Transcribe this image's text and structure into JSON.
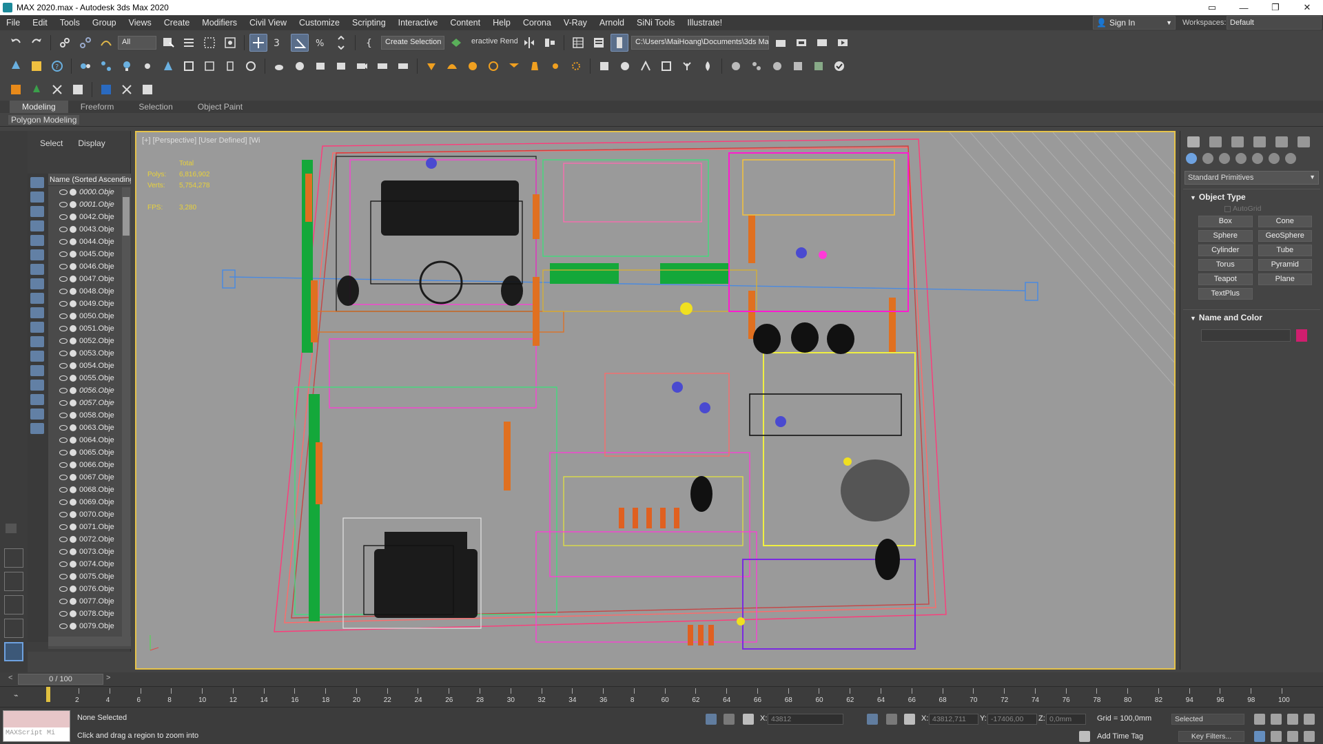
{
  "window": {
    "title": "MAX 2020.max - Autodesk 3ds Max 2020"
  },
  "menu": [
    "File",
    "Edit",
    "Tools",
    "Group",
    "Views",
    "Create",
    "Modifiers",
    "Civil View",
    "Customize",
    "Scripting",
    "Interactive",
    "Content",
    "Help",
    "Corona",
    "V-Ray",
    "Arnold",
    "SiNi Tools",
    "Illustrate!"
  ],
  "account": {
    "sign_in": "Sign In",
    "workspaces_label": "Workspaces:",
    "workspace": "Default"
  },
  "toolbar": {
    "filter": "All",
    "selection_set": "Create Selection Se",
    "render_label": "eractive Rend",
    "project_path": "C:\\Users\\MaiHoang\\Documents\\3ds Max 2020"
  },
  "ribbon": {
    "tabs": [
      "Modeling",
      "Freeform",
      "Selection",
      "Object Paint"
    ],
    "active": "Modeling",
    "sub_label": "Polygon Modeling"
  },
  "explorer": {
    "tabs": [
      "Select",
      "Display"
    ],
    "column_header": "Name (Sorted Ascending",
    "items": [
      {
        "name": "0000.Obje",
        "italic": true
      },
      {
        "name": "0001.Obje",
        "italic": true
      },
      {
        "name": "0042.Obje",
        "italic": false
      },
      {
        "name": "0043.Obje",
        "italic": false
      },
      {
        "name": "0044.Obje",
        "italic": false
      },
      {
        "name": "0045.Obje",
        "italic": false
      },
      {
        "name": "0046.Obje",
        "italic": false
      },
      {
        "name": "0047.Obje",
        "italic": false
      },
      {
        "name": "0048.Obje",
        "italic": false
      },
      {
        "name": "0049.Obje",
        "italic": false
      },
      {
        "name": "0050.Obje",
        "italic": false
      },
      {
        "name": "0051.Obje",
        "italic": false
      },
      {
        "name": "0052.Obje",
        "italic": false
      },
      {
        "name": "0053.Obje",
        "italic": false
      },
      {
        "name": "0054.Obje",
        "italic": false
      },
      {
        "name": "0055.Obje",
        "italic": false
      },
      {
        "name": "0056.Obje",
        "italic": true
      },
      {
        "name": "0057.Obje",
        "italic": true
      },
      {
        "name": "0058.Obje",
        "italic": false
      },
      {
        "name": "0063.Obje",
        "italic": false
      },
      {
        "name": "0064.Obje",
        "italic": false
      },
      {
        "name": "0065.Obje",
        "italic": false
      },
      {
        "name": "0066.Obje",
        "italic": false
      },
      {
        "name": "0067.Obje",
        "italic": false
      },
      {
        "name": "0068.Obje",
        "italic": false
      },
      {
        "name": "0069.Obje",
        "italic": false
      },
      {
        "name": "0070.Obje",
        "italic": false
      },
      {
        "name": "0071.Obje",
        "italic": false
      },
      {
        "name": "0072.Obje",
        "italic": false
      },
      {
        "name": "0073.Obje",
        "italic": false
      },
      {
        "name": "0074.Obje",
        "italic": false
      },
      {
        "name": "0075.Obje",
        "italic": false
      },
      {
        "name": "0076.Obje",
        "italic": false
      },
      {
        "name": "0077.Obje",
        "italic": false
      },
      {
        "name": "0078.Obje",
        "italic": false
      },
      {
        "name": "0079.Obje",
        "italic": false
      }
    ]
  },
  "viewport": {
    "label": "[+] [Perspective] [User Defined] [Wi",
    "stats": {
      "total": "Total",
      "polys_label": "Polys:",
      "polys": "6,816,902",
      "verts_label": "Verts:",
      "verts": "5,754,278",
      "fps_label": "FPS:",
      "fps": "3,280"
    }
  },
  "command_panel": {
    "category": "Standard Primitives",
    "object_type_title": "Object Type",
    "autogrid": "AutoGrid",
    "buttons": [
      "Box",
      "Cone",
      "Sphere",
      "GeoSphere",
      "Cylinder",
      "Tube",
      "Torus",
      "Pyramid",
      "Teapot",
      "Plane",
      "TextPlus"
    ],
    "name_color_title": "Name and Color",
    "swatch_color": "#d01e6e"
  },
  "timeline": {
    "slider": "0 / 100",
    "ticks": [
      "2",
      "4",
      "6",
      "8",
      "10",
      "12",
      "14",
      "16",
      "18",
      "20",
      "22",
      "24",
      "26",
      "28",
      "30",
      "32",
      "34",
      "36",
      "8",
      "60",
      "62",
      "64",
      "66",
      "68",
      "60",
      "62",
      "64",
      "66",
      "68",
      "70",
      "72",
      "74",
      "76",
      "78",
      "80",
      "82",
      "94",
      "96",
      "98",
      "100"
    ]
  },
  "status": {
    "maxscript": "MAXScript Mi",
    "selection": "None Selected",
    "prompt": "Click and drag a region to zoom into",
    "x1_label": "X:",
    "x1": "43812",
    "x_label": "X:",
    "x": "43812,711",
    "y_label": "Y:",
    "y": "-17406,00",
    "z_label": "Z:",
    "z": "0,0mm",
    "grid": "Grid = 100,0mm",
    "selected": "Selected",
    "add_time_tag": "Add Time Tag",
    "key_filters": "Key Filters..."
  }
}
